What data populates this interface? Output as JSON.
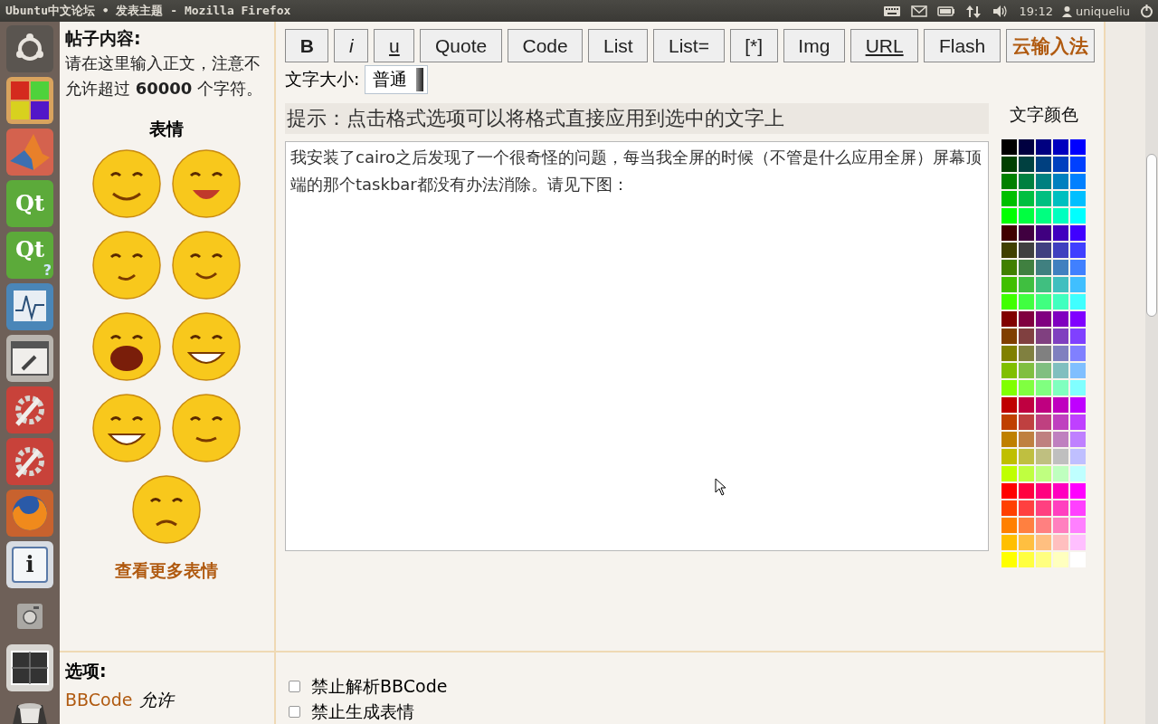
{
  "window": {
    "title": "Ubuntu中文论坛 • 发表主题 - Mozilla Firefox"
  },
  "panel": {
    "indicators": [
      {
        "kind": "keyboard"
      },
      {
        "kind": "mail"
      },
      {
        "kind": "battery"
      },
      {
        "kind": "network"
      },
      {
        "kind": "volume"
      }
    ],
    "clock": "19:12",
    "user": "uniqueliu"
  },
  "launcher": [
    {
      "kind": "dash"
    },
    {
      "kind": "cubes"
    },
    {
      "kind": "matlab"
    },
    {
      "kind": "qt",
      "glyph": "Qt"
    },
    {
      "kind": "qt-help",
      "glyph": "Qt",
      "badge": "?"
    },
    {
      "kind": "monitor"
    },
    {
      "kind": "window-tools"
    },
    {
      "kind": "settings"
    },
    {
      "kind": "settings"
    },
    {
      "kind": "firefox"
    },
    {
      "kind": "info",
      "glyph": "i"
    },
    {
      "kind": "camera"
    },
    {
      "kind": "workspaces"
    },
    {
      "kind": "trash"
    }
  ],
  "post_content": {
    "heading": "帖子内容:",
    "note": "请在这里输入正文，注意不允许超过 **60000** 个字符。",
    "emoticons_heading": "表情",
    "emoticons": [
      {
        "kind": "smile"
      },
      {
        "kind": "tongue"
      },
      {
        "kind": "shy"
      },
      {
        "kind": "giggle"
      },
      {
        "kind": "laugh"
      },
      {
        "kind": "grin"
      },
      {
        "kind": "grin"
      },
      {
        "kind": "sly"
      },
      {
        "kind": "dizzy"
      }
    ],
    "more_emoticons": "查看更多表情"
  },
  "toolbar": {
    "buttons": [
      {
        "label": "B",
        "kind": "bold"
      },
      {
        "label": "i",
        "kind": "italic"
      },
      {
        "label": "u",
        "kind": "underline"
      },
      {
        "label": "Quote",
        "kind": "plain"
      },
      {
        "label": "Code",
        "kind": "plain"
      },
      {
        "label": "List",
        "kind": "plain"
      },
      {
        "label": "List=",
        "kind": "plain"
      },
      {
        "label": "[*]",
        "kind": "plain"
      },
      {
        "label": "Img",
        "kind": "plain"
      },
      {
        "label": "URL",
        "kind": "underline"
      },
      {
        "label": "Flash",
        "kind": "plain"
      },
      {
        "label": "云输入法",
        "kind": "accent"
      }
    ],
    "font_size": {
      "label": "文字大小:",
      "value": "普通"
    }
  },
  "hint": "提示：点击格式选项可以将格式直接应用到选中的文字上",
  "editor": {
    "value": "我安装了cairo之后发现了一个很奇怪的问题，每当我全屏的时候（不管是什么应用全屏）屏幕顶端的那个taskbar都没有办法消除。请见下图："
  },
  "color_palette": {
    "label": "文字颜色",
    "rows": [
      {
        "swatches": [
          {
            "color": "#000000"
          },
          {
            "color": "#000040"
          },
          {
            "color": "#000080"
          },
          {
            "color": "#0000bf"
          },
          {
            "color": "#0000ff"
          }
        ]
      },
      {
        "swatches": [
          {
            "color": "#004000"
          },
          {
            "color": "#004040"
          },
          {
            "color": "#004080"
          },
          {
            "color": "#0040bf"
          },
          {
            "color": "#0040ff"
          }
        ]
      },
      {
        "swatches": [
          {
            "color": "#008000"
          },
          {
            "color": "#008040"
          },
          {
            "color": "#008080"
          },
          {
            "color": "#0080bf"
          },
          {
            "color": "#0080ff"
          }
        ]
      },
      {
        "swatches": [
          {
            "color": "#00bf00"
          },
          {
            "color": "#00bf40"
          },
          {
            "color": "#00bf80"
          },
          {
            "color": "#00bfbf"
          },
          {
            "color": "#00bfff"
          }
        ]
      },
      {
        "swatches": [
          {
            "color": "#00ff00"
          },
          {
            "color": "#00ff40"
          },
          {
            "color": "#00ff80"
          },
          {
            "color": "#00ffbf"
          },
          {
            "color": "#00ffff"
          }
        ]
      },
      {
        "swatches": [
          {
            "color": "#400000"
          },
          {
            "color": "#400040"
          },
          {
            "color": "#400080"
          },
          {
            "color": "#4000bf"
          },
          {
            "color": "#4000ff"
          }
        ]
      },
      {
        "swatches": [
          {
            "color": "#404000"
          },
          {
            "color": "#404040"
          },
          {
            "color": "#404080"
          },
          {
            "color": "#4040bf"
          },
          {
            "color": "#4040ff"
          }
        ]
      },
      {
        "swatches": [
          {
            "color": "#408000"
          },
          {
            "color": "#408040"
          },
          {
            "color": "#408080"
          },
          {
            "color": "#4080bf"
          },
          {
            "color": "#4080ff"
          }
        ]
      },
      {
        "swatches": [
          {
            "color": "#40bf00"
          },
          {
            "color": "#40bf40"
          },
          {
            "color": "#40bf80"
          },
          {
            "color": "#40bfbf"
          },
          {
            "color": "#40bfff"
          }
        ]
      },
      {
        "swatches": [
          {
            "color": "#40ff00"
          },
          {
            "color": "#40ff40"
          },
          {
            "color": "#40ff80"
          },
          {
            "color": "#40ffbf"
          },
          {
            "color": "#40ffff"
          }
        ]
      },
      {
        "swatches": [
          {
            "color": "#800000"
          },
          {
            "color": "#800040"
          },
          {
            "color": "#800080"
          },
          {
            "color": "#8000bf"
          },
          {
            "color": "#8000ff"
          }
        ]
      },
      {
        "swatches": [
          {
            "color": "#804000"
          },
          {
            "color": "#804040"
          },
          {
            "color": "#804080"
          },
          {
            "color": "#8040bf"
          },
          {
            "color": "#8040ff"
          }
        ]
      },
      {
        "swatches": [
          {
            "color": "#808000"
          },
          {
            "color": "#808040"
          },
          {
            "color": "#808080"
          },
          {
            "color": "#8080bf"
          },
          {
            "color": "#8080ff"
          }
        ]
      },
      {
        "swatches": [
          {
            "color": "#80bf00"
          },
          {
            "color": "#80bf40"
          },
          {
            "color": "#80bf80"
          },
          {
            "color": "#80bfbf"
          },
          {
            "color": "#80bfff"
          }
        ]
      },
      {
        "swatches": [
          {
            "color": "#80ff00"
          },
          {
            "color": "#80ff40"
          },
          {
            "color": "#80ff80"
          },
          {
            "color": "#80ffbf"
          },
          {
            "color": "#80ffff"
          }
        ]
      },
      {
        "swatches": [
          {
            "color": "#bf0000"
          },
          {
            "color": "#bf0040"
          },
          {
            "color": "#bf0080"
          },
          {
            "color": "#bf00bf"
          },
          {
            "color": "#bf00ff"
          }
        ]
      },
      {
        "swatches": [
          {
            "color": "#bf4000"
          },
          {
            "color": "#bf4040"
          },
          {
            "color": "#bf4080"
          },
          {
            "color": "#bf40bf"
          },
          {
            "color": "#bf40ff"
          }
        ]
      },
      {
        "swatches": [
          {
            "color": "#bf8000"
          },
          {
            "color": "#bf8040"
          },
          {
            "color": "#bf8080"
          },
          {
            "color": "#bf80bf"
          },
          {
            "color": "#bf80ff"
          }
        ]
      },
      {
        "swatches": [
          {
            "color": "#bfbf00"
          },
          {
            "color": "#bfbf40"
          },
          {
            "color": "#bfbf80"
          },
          {
            "color": "#bfbfbf"
          },
          {
            "color": "#bfbfff"
          }
        ]
      },
      {
        "swatches": [
          {
            "color": "#bfff00"
          },
          {
            "color": "#bfff40"
          },
          {
            "color": "#bfff80"
          },
          {
            "color": "#bfffbf"
          },
          {
            "color": "#bfffff"
          }
        ]
      },
      {
        "swatches": [
          {
            "color": "#ff0000"
          },
          {
            "color": "#ff0040"
          },
          {
            "color": "#ff0080"
          },
          {
            "color": "#ff00bf"
          },
          {
            "color": "#ff00ff"
          }
        ]
      },
      {
        "swatches": [
          {
            "color": "#ff4000"
          },
          {
            "color": "#ff4040"
          },
          {
            "color": "#ff4080"
          },
          {
            "color": "#ff40bf"
          },
          {
            "color": "#ff40ff"
          }
        ]
      },
      {
        "swatches": [
          {
            "color": "#ff8000"
          },
          {
            "color": "#ff8040"
          },
          {
            "color": "#ff8080"
          },
          {
            "color": "#ff80bf"
          },
          {
            "color": "#ff80ff"
          }
        ]
      },
      {
        "swatches": [
          {
            "color": "#ffbf00"
          },
          {
            "color": "#ffbf40"
          },
          {
            "color": "#ffbf80"
          },
          {
            "color": "#ffbfbf"
          },
          {
            "color": "#ffbfff"
          }
        ]
      },
      {
        "swatches": [
          {
            "color": "#ffff00"
          },
          {
            "color": "#ffff40"
          },
          {
            "color": "#ffff80"
          },
          {
            "color": "#ffffbf"
          },
          {
            "color": "#ffffff"
          }
        ]
      }
    ]
  },
  "options": {
    "heading": "选项:",
    "bbcode_link": "BBCode",
    "bbcode_state": "允许",
    "checkboxes": [
      {
        "label": "禁止解析BBCode",
        "checked": false
      },
      {
        "label": "禁止生成表情",
        "checked": false
      }
    ]
  }
}
